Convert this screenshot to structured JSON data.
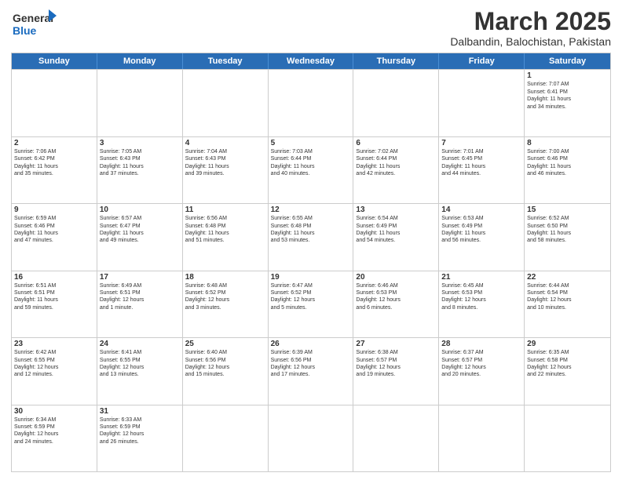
{
  "header": {
    "logo_general": "General",
    "logo_blue": "Blue",
    "title": "March 2025",
    "subtitle": "Dalbandin, Balochistan, Pakistan"
  },
  "days": [
    "Sunday",
    "Monday",
    "Tuesday",
    "Wednesday",
    "Thursday",
    "Friday",
    "Saturday"
  ],
  "weeks": [
    [
      {
        "day": "",
        "info": ""
      },
      {
        "day": "",
        "info": ""
      },
      {
        "day": "",
        "info": ""
      },
      {
        "day": "",
        "info": ""
      },
      {
        "day": "",
        "info": ""
      },
      {
        "day": "",
        "info": ""
      },
      {
        "day": "1",
        "info": "Sunrise: 7:07 AM\nSunset: 6:41 PM\nDaylight: 11 hours\nand 34 minutes."
      }
    ],
    [
      {
        "day": "2",
        "info": "Sunrise: 7:06 AM\nSunset: 6:42 PM\nDaylight: 11 hours\nand 35 minutes."
      },
      {
        "day": "3",
        "info": "Sunrise: 7:05 AM\nSunset: 6:43 PM\nDaylight: 11 hours\nand 37 minutes."
      },
      {
        "day": "4",
        "info": "Sunrise: 7:04 AM\nSunset: 6:43 PM\nDaylight: 11 hours\nand 39 minutes."
      },
      {
        "day": "5",
        "info": "Sunrise: 7:03 AM\nSunset: 6:44 PM\nDaylight: 11 hours\nand 40 minutes."
      },
      {
        "day": "6",
        "info": "Sunrise: 7:02 AM\nSunset: 6:44 PM\nDaylight: 11 hours\nand 42 minutes."
      },
      {
        "day": "7",
        "info": "Sunrise: 7:01 AM\nSunset: 6:45 PM\nDaylight: 11 hours\nand 44 minutes."
      },
      {
        "day": "8",
        "info": "Sunrise: 7:00 AM\nSunset: 6:46 PM\nDaylight: 11 hours\nand 46 minutes."
      }
    ],
    [
      {
        "day": "9",
        "info": "Sunrise: 6:59 AM\nSunset: 6:46 PM\nDaylight: 11 hours\nand 47 minutes."
      },
      {
        "day": "10",
        "info": "Sunrise: 6:57 AM\nSunset: 6:47 PM\nDaylight: 11 hours\nand 49 minutes."
      },
      {
        "day": "11",
        "info": "Sunrise: 6:56 AM\nSunset: 6:48 PM\nDaylight: 11 hours\nand 51 minutes."
      },
      {
        "day": "12",
        "info": "Sunrise: 6:55 AM\nSunset: 6:48 PM\nDaylight: 11 hours\nand 53 minutes."
      },
      {
        "day": "13",
        "info": "Sunrise: 6:54 AM\nSunset: 6:49 PM\nDaylight: 11 hours\nand 54 minutes."
      },
      {
        "day": "14",
        "info": "Sunrise: 6:53 AM\nSunset: 6:49 PM\nDaylight: 11 hours\nand 56 minutes."
      },
      {
        "day": "15",
        "info": "Sunrise: 6:52 AM\nSunset: 6:50 PM\nDaylight: 11 hours\nand 58 minutes."
      }
    ],
    [
      {
        "day": "16",
        "info": "Sunrise: 6:51 AM\nSunset: 6:51 PM\nDaylight: 11 hours\nand 59 minutes."
      },
      {
        "day": "17",
        "info": "Sunrise: 6:49 AM\nSunset: 6:51 PM\nDaylight: 12 hours\nand 1 minute."
      },
      {
        "day": "18",
        "info": "Sunrise: 6:48 AM\nSunset: 6:52 PM\nDaylight: 12 hours\nand 3 minutes."
      },
      {
        "day": "19",
        "info": "Sunrise: 6:47 AM\nSunset: 6:52 PM\nDaylight: 12 hours\nand 5 minutes."
      },
      {
        "day": "20",
        "info": "Sunrise: 6:46 AM\nSunset: 6:53 PM\nDaylight: 12 hours\nand 6 minutes."
      },
      {
        "day": "21",
        "info": "Sunrise: 6:45 AM\nSunset: 6:53 PM\nDaylight: 12 hours\nand 8 minutes."
      },
      {
        "day": "22",
        "info": "Sunrise: 6:44 AM\nSunset: 6:54 PM\nDaylight: 12 hours\nand 10 minutes."
      }
    ],
    [
      {
        "day": "23",
        "info": "Sunrise: 6:42 AM\nSunset: 6:55 PM\nDaylight: 12 hours\nand 12 minutes."
      },
      {
        "day": "24",
        "info": "Sunrise: 6:41 AM\nSunset: 6:55 PM\nDaylight: 12 hours\nand 13 minutes."
      },
      {
        "day": "25",
        "info": "Sunrise: 6:40 AM\nSunset: 6:56 PM\nDaylight: 12 hours\nand 15 minutes."
      },
      {
        "day": "26",
        "info": "Sunrise: 6:39 AM\nSunset: 6:56 PM\nDaylight: 12 hours\nand 17 minutes."
      },
      {
        "day": "27",
        "info": "Sunrise: 6:38 AM\nSunset: 6:57 PM\nDaylight: 12 hours\nand 19 minutes."
      },
      {
        "day": "28",
        "info": "Sunrise: 6:37 AM\nSunset: 6:57 PM\nDaylight: 12 hours\nand 20 minutes."
      },
      {
        "day": "29",
        "info": "Sunrise: 6:35 AM\nSunset: 6:58 PM\nDaylight: 12 hours\nand 22 minutes."
      }
    ],
    [
      {
        "day": "30",
        "info": "Sunrise: 6:34 AM\nSunset: 6:59 PM\nDaylight: 12 hours\nand 24 minutes."
      },
      {
        "day": "31",
        "info": "Sunrise: 6:33 AM\nSunset: 6:59 PM\nDaylight: 12 hours\nand 26 minutes."
      },
      {
        "day": "",
        "info": ""
      },
      {
        "day": "",
        "info": ""
      },
      {
        "day": "",
        "info": ""
      },
      {
        "day": "",
        "info": ""
      },
      {
        "day": "",
        "info": ""
      }
    ]
  ]
}
